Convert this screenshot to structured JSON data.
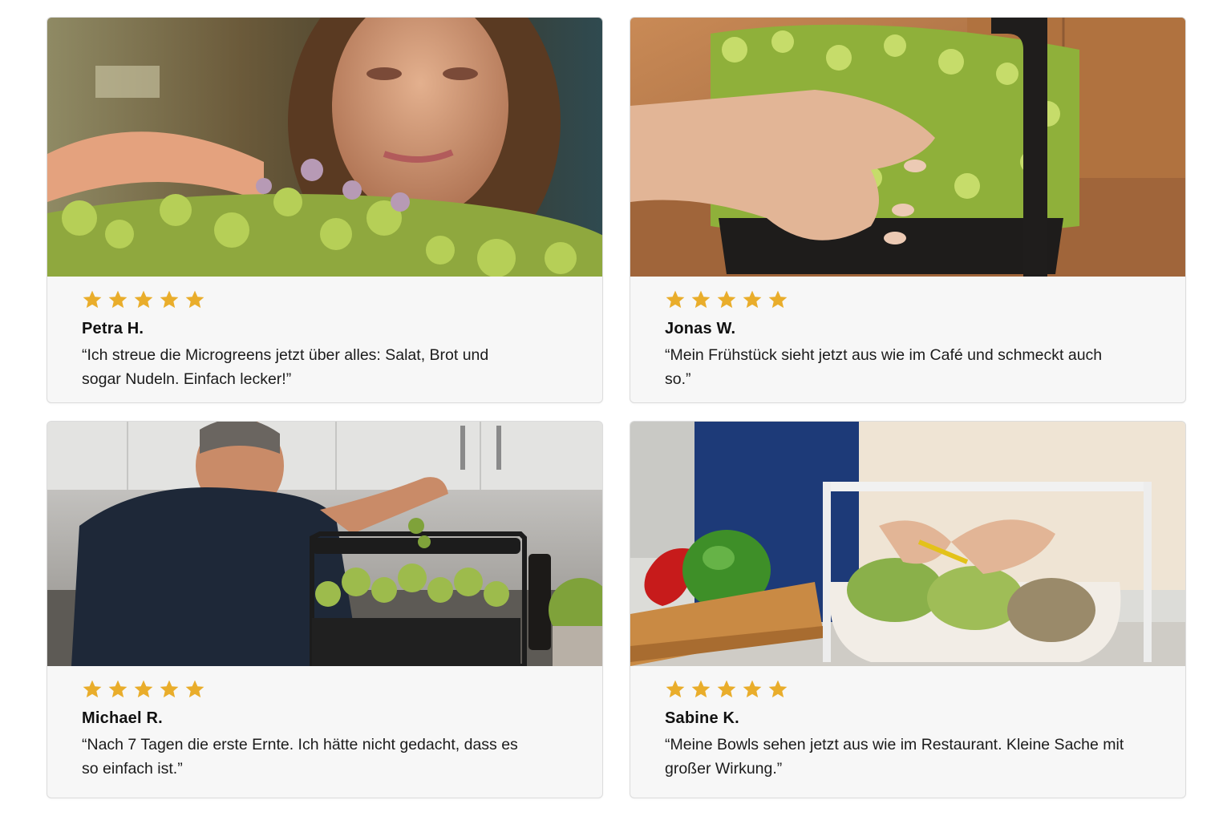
{
  "reviews": [
    {
      "rating": 5,
      "name": "Petra H.",
      "quote": "“Ich streue die Microgreens jetzt über alles: Salat, Brot und sogar Nudeln. Einfach lecker!”"
    },
    {
      "rating": 5,
      "name": "Jonas W.",
      "quote": "“Mein Frühstück sieht jetzt aus wie im Café und schmeckt auch so.”"
    },
    {
      "rating": 5,
      "name": "Michael R.",
      "quote": "“Nach 7 Tagen die erste Ernte. Ich hätte nicht gedacht, dass es so einfach ist.”"
    },
    {
      "rating": 5,
      "name": "Sabine K.",
      "quote": "“Meine Bowls sehen jetzt aus wie im Restaurant. Kleine Sache mit großer Wirkung.”"
    }
  ],
  "colors": {
    "star": "#e9ad2b",
    "card_bg": "#f7f7f7",
    "card_border": "#dcdcdc",
    "text": "#111111"
  },
  "icons": {
    "star": "star-icon"
  }
}
